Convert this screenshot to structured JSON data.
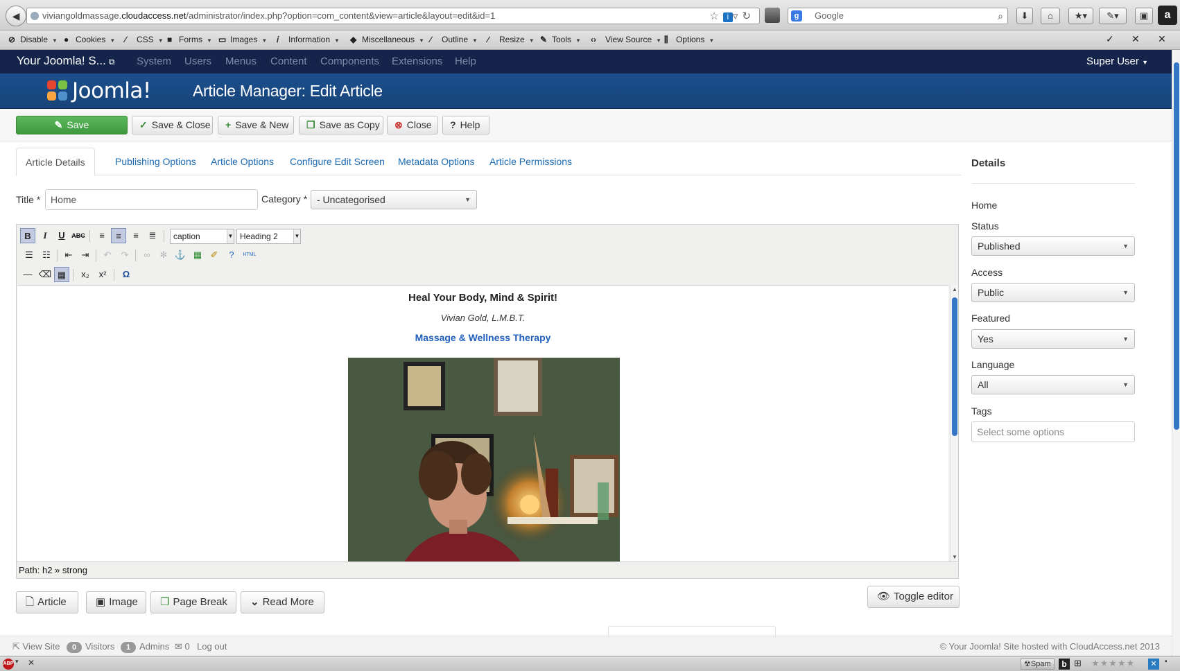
{
  "browser": {
    "url_prefix": "viviangoldmassage.",
    "url_host": "cloudaccess.net",
    "url_path": "/administrator/index.php?option=com_content&view=article&layout=edit&id=1",
    "search_placeholder": "Google"
  },
  "devbar": {
    "items": [
      "Disable",
      "Cookies",
      "CSS",
      "Forms",
      "Images",
      "Information",
      "Miscellaneous",
      "Outline",
      "Resize",
      "Tools",
      "View Source",
      "Options"
    ]
  },
  "admin": {
    "site_name": "Your Joomla! S...",
    "nav": [
      "System",
      "Users",
      "Menus",
      "Content",
      "Components",
      "Extensions",
      "Help"
    ],
    "user": "Super User",
    "logo_text": "Joomla!",
    "page_title": "Article Manager: Edit Article"
  },
  "toolbar": {
    "save": "Save",
    "save_close": "Save & Close",
    "save_new": "Save & New",
    "save_copy": "Save as Copy",
    "close": "Close",
    "help": "Help"
  },
  "tabs": [
    "Article Details",
    "Publishing Options",
    "Article Options",
    "Configure Edit Screen",
    "Metadata Options",
    "Article Permissions"
  ],
  "form": {
    "title_label": "Title *",
    "title_value": "Home",
    "category_label": "Category *",
    "category_value": "- Uncategorised"
  },
  "editor": {
    "style_select": "caption",
    "format_select": "Heading 2",
    "html_label": "HTML",
    "content": {
      "heading": "Heal Your Body, Mind & Spirit!",
      "author": "Vivian Gold, L.M.B.T.",
      "subtitle": "Massage & Wellness Therapy"
    },
    "path": "Path: h2 » strong"
  },
  "editor_buttons": {
    "article": "Article",
    "image": "Image",
    "page_break": "Page Break",
    "read_more": "Read More",
    "toggle": "Toggle editor"
  },
  "details": {
    "title": "Details",
    "alias": "Home",
    "status_label": "Status",
    "status_value": "Published",
    "access_label": "Access",
    "access_value": "Public",
    "featured_label": "Featured",
    "featured_value": "Yes",
    "language_label": "Language",
    "language_value": "All",
    "tags_label": "Tags",
    "tags_placeholder": "Select some options"
  },
  "footer": {
    "view_site": "View Site",
    "visitors_count": "0",
    "visitors": "Visitors",
    "admins_count": "1",
    "admins": "Admins",
    "messages_count": "0",
    "logout": "Log out",
    "copyright": "© Your Joomla! Site hosted with CloudAccess.net 2013"
  },
  "statusbar": {
    "spam": "Spam"
  },
  "colors": {
    "nav_bg": "#15244b",
    "header_bg": "#1c4f8d",
    "save_green": "#4cae4c",
    "link_blue": "#1a6bb3",
    "subtitle_blue": "#1f5fbd"
  }
}
